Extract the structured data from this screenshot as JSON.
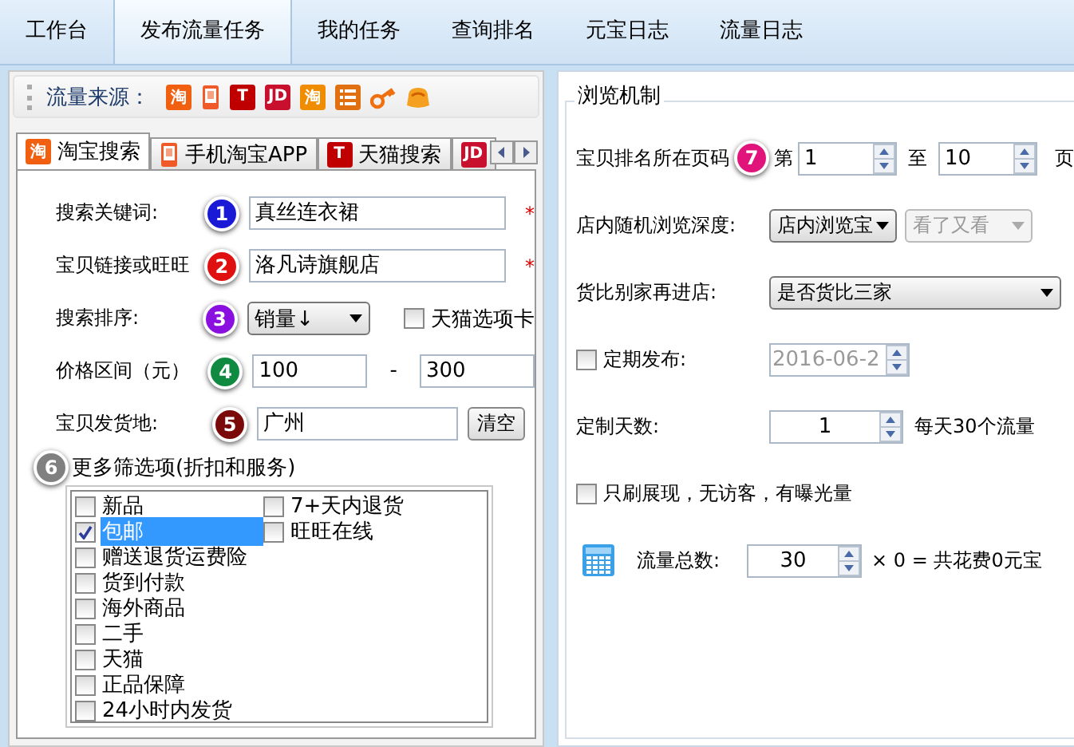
{
  "top_tabs": [
    {
      "label": "工作台",
      "selected": false
    },
    {
      "label": "发布流量任务",
      "selected": true
    },
    {
      "label": "我的任务",
      "selected": false
    },
    {
      "label": "查询排名",
      "selected": false
    },
    {
      "label": "元宝日志",
      "selected": false
    },
    {
      "label": "流量日志",
      "selected": false
    }
  ],
  "source_bar": {
    "label": "流量来源：",
    "icons": [
      {
        "kind": "glyph",
        "glyph": "淘",
        "color": "#f06010"
      },
      {
        "kind": "phone"
      },
      {
        "kind": "glyph",
        "glyph": "T",
        "color": "#c00000"
      },
      {
        "kind": "glyph",
        "glyph": "JD",
        "color": "#c8102e"
      },
      {
        "kind": "glyph",
        "glyph": "淘",
        "color": "#f08c00"
      },
      {
        "kind": "list"
      },
      {
        "kind": "key"
      },
      {
        "kind": "bag"
      }
    ]
  },
  "search_tabs": [
    {
      "label": "淘宝搜索",
      "selected": true,
      "icon": {
        "kind": "glyph",
        "glyph": "淘",
        "color": "#f06010"
      }
    },
    {
      "label": "手机淘宝APP",
      "selected": false,
      "icon": {
        "kind": "phone"
      }
    },
    {
      "label": "天猫搜索",
      "selected": false,
      "icon": {
        "kind": "glyph",
        "glyph": "T",
        "color": "#c00000"
      }
    },
    {
      "selected": false,
      "icon": {
        "kind": "glyph",
        "glyph": "JD",
        "color": "#c8102e"
      }
    }
  ],
  "fields": [
    {
      "kind": "text",
      "label": "搜索关键词:",
      "badge": {
        "number": "1",
        "color": "#1a1ad6"
      },
      "value": "真丝连衣裙",
      "required": "*"
    },
    {
      "kind": "text",
      "label": "宝贝链接或旺旺",
      "badge": {
        "number": "2",
        "color": "#e01010"
      },
      "value": "洛凡诗旗舰店",
      "required": "*"
    },
    {
      "kind": "select",
      "label": "搜索排序:",
      "badge": {
        "number": "3",
        "color": "#8a10e0"
      },
      "value": "销量↓",
      "checkbox": {
        "label": "天猫选项卡",
        "checked": false
      }
    },
    {
      "kind": "range",
      "label": "价格区间（元）",
      "badge": {
        "number": "4",
        "color": "#108a40"
      },
      "min": "100",
      "separator": "-",
      "max": "300"
    },
    {
      "kind": "text_button",
      "label": "宝贝发货地:",
      "badge": {
        "number": "5",
        "color": "#7a0a0a"
      },
      "value": "广州",
      "button": "清空"
    }
  ],
  "filters": {
    "badge": {
      "number": "6",
      "color": "#808080"
    },
    "title": "更多筛选项(折扣和服务)",
    "columns": [
      [
        {
          "label": "新品",
          "checked": false,
          "selected": false
        },
        {
          "label": "包邮",
          "checked": true,
          "selected": true
        },
        {
          "label": "赠送退货运费险",
          "checked": false,
          "selected": false
        },
        {
          "label": "货到付款",
          "checked": false,
          "selected": false
        },
        {
          "label": "海外商品",
          "checked": false,
          "selected": false
        },
        {
          "label": "二手",
          "checked": false,
          "selected": false
        },
        {
          "label": "天猫",
          "checked": false,
          "selected": false
        },
        {
          "label": "正品保障",
          "checked": false,
          "selected": false
        },
        {
          "label": "24小时内发货",
          "checked": false,
          "selected": false
        }
      ],
      [
        {
          "label": "7+天内退货",
          "checked": false,
          "selected": false
        },
        {
          "label": "旺旺在线",
          "checked": false,
          "selected": false
        }
      ]
    ]
  },
  "browse": {
    "title": "浏览机制",
    "rows": [
      {
        "kind": "page_range",
        "label": "宝贝排名所在页码",
        "badge": {
          "number": "7",
          "color": "#e0147a"
        },
        "prefix": "第",
        "from": "1",
        "middle": "至",
        "to": "10",
        "suffix": "页"
      },
      {
        "kind": "selects",
        "label": "店内随机浏览深度:",
        "selects": [
          {
            "value": "店内浏览宝",
            "disabled": false
          },
          {
            "value": "看了又看",
            "disabled": true
          }
        ]
      },
      {
        "kind": "selects",
        "label": "货比别家再进店:",
        "selects": [
          {
            "value": "是否货比三家",
            "disabled": false
          }
        ]
      },
      {
        "kind": "date",
        "label": "定期发布:",
        "checked": false,
        "value": "2016-06-2",
        "disabled": true
      },
      {
        "kind": "spinner",
        "label": "定制天数:",
        "value": "1",
        "note": "每天30个流量"
      },
      {
        "kind": "check",
        "label": "只刷展现，无访客，有曝光量",
        "checked": false
      },
      {
        "kind": "total",
        "label": "流量总数:",
        "value": "30",
        "note": "× 0 = 共花费0元宝"
      }
    ]
  }
}
